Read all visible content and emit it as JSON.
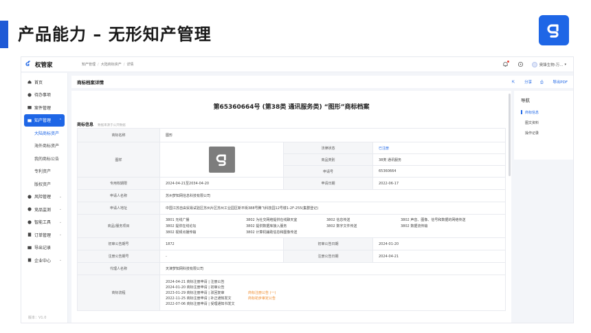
{
  "slide": {
    "title": "产品能力 – 无形知产管理"
  },
  "app": {
    "brand": "权管家",
    "breadcrumb": [
      "知产管理",
      "大陆商标资产",
      "详情"
    ],
    "user_name": "奥锋生物-万..."
  },
  "sidebar": {
    "items": [
      {
        "label": "首页"
      },
      {
        "label": "待办事项"
      },
      {
        "label": "案件管理"
      },
      {
        "label": "知产管理"
      },
      {
        "label": "风险管理"
      },
      {
        "label": "竞品监测"
      },
      {
        "label": "智能工具"
      },
      {
        "label": "订单管理"
      },
      {
        "label": "导出记录"
      },
      {
        "label": "企业中心"
      }
    ],
    "subitems": [
      "大陆商标资产",
      "海外商标资产",
      "我的商标公告",
      "专利资产",
      "版权资产"
    ],
    "version": "版本：V1.0"
  },
  "header": {
    "title": "商标档案详情",
    "share": "分享",
    "export": "导出PDF"
  },
  "document": {
    "title": "第65360664号 (第38类 通讯服务类) “图形”商标档案",
    "section": "商标信息",
    "section_note": "数据来源于公开数据",
    "rows": {
      "name_label": "商标名称",
      "name_value": "图形",
      "image_label": "图样",
      "status_label": "法律状态",
      "status_value": "已注册",
      "class_label": "商品类别",
      "class_value": "38类 通讯服务",
      "regno_label": "申请号",
      "regno_value": "65360664",
      "valid_label": "专用权期限",
      "valid_value": "2024-04-21至2034-04-20",
      "appdate_label": "申请日期",
      "appdate_value": "2022-06-17",
      "applicant_label": "申请人名称",
      "applicant_value": "苏州梦知网信息科技有限公司",
      "address_label": "申请人地址",
      "address_value": "中国江苏自由贸易试验区苏州片区苏州工业园区新平街388号腾飞科技园12号楼1-2F-255(集群登记)",
      "goods_label": "商品/服务项目",
      "goods": [
        "3801 无线广播",
        "3802 为社交网络提供在线聊天室",
        "3802 信息传送",
        "3802 声音、图像、信号和数据的网络传送",
        "3802 提供在线论坛",
        "3802 提供数据库接入服务",
        "3802 数字文件传送",
        "3802 数据流传输",
        "3802 视频点播传输",
        "3802 计算机辅助信息和图像传送",
        "",
        ""
      ],
      "prelim_no_label": "初审公告期号",
      "prelim_no_value": "1872",
      "prelim_date_label": "初审公告日期",
      "prelim_date_value": "2024-01-20",
      "reg_no_label": "注册公告期号",
      "reg_no_value": "-",
      "reg_date_label": "注册公告日期",
      "reg_date_value": "2024-04-21",
      "agent_label": "代理人名称",
      "agent_value": "天津梦知网科技有限公司",
      "flow_label": "商标流程",
      "flow": [
        {
          "text": "2024-04-21 商标注册申请 | 注册公告",
          "link": ""
        },
        {
          "text": "2024-01-20 商标注册申请 | 初审公告",
          "link": ""
        },
        {
          "text": "2023-01-29 商标注册申请 | 驳回复审",
          "link": "商标注册公告 (一)"
        },
        {
          "text": "2022-11-25 商标注册申请 | 补正通知发文",
          "link": "商标初步审定公告"
        },
        {
          "text": "2022-07-06 商标注册申请 | 受理通知书发文",
          "link": ""
        }
      ]
    }
  },
  "rightnav": {
    "title": "导航",
    "items": [
      "商标信息",
      "图文资料",
      "操作记录"
    ]
  },
  "colors": {
    "accent": "#1e66e6",
    "orange": "#ef8a2b"
  }
}
